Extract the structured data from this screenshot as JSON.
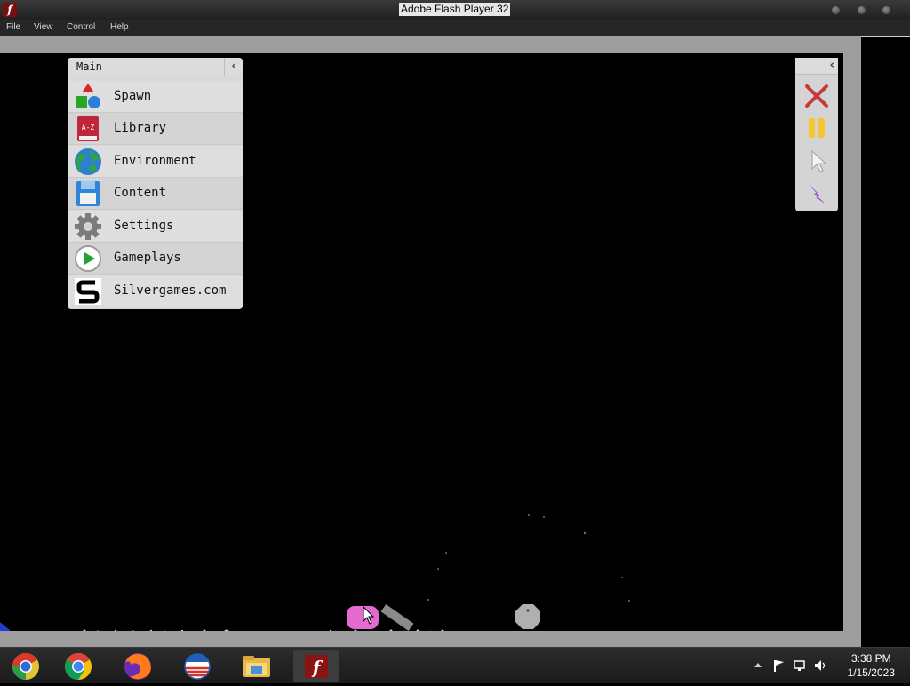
{
  "window": {
    "title": "Adobe Flash Player 32"
  },
  "menubar": {
    "items": [
      "File",
      "View",
      "Control",
      "Help"
    ]
  },
  "main_panel": {
    "title": "Main",
    "items": [
      {
        "label": "Spawn",
        "icon": "shapes-icon"
      },
      {
        "label": "Library",
        "icon": "book-icon"
      },
      {
        "label": "Environment",
        "icon": "globe-icon"
      },
      {
        "label": "Content",
        "icon": "floppy-disk-icon"
      },
      {
        "label": "Settings",
        "icon": "gear-icon"
      },
      {
        "label": "Gameplays",
        "icon": "play-icon"
      },
      {
        "label": "Silvergames.com",
        "icon": "silvergames-logo-icon"
      }
    ]
  },
  "library_icon_text": "A-Z",
  "tool_panel": {
    "tools": [
      "close-icon",
      "pause-icon",
      "cursor-icon",
      "lightning-icon"
    ]
  },
  "taskbar": {
    "apps": [
      "chrome-icon",
      "chrome-icon",
      "firefox-icon",
      "browser-icon",
      "file-explorer-icon",
      "flash-player-icon"
    ],
    "time": "3:38 PM",
    "date": "1/15/2023"
  },
  "colors": {
    "titlebar": "#2a2a2a",
    "panel_bg": "#d9d9d9",
    "stage_bg": "#000000",
    "pink_object": "#e36bd0"
  }
}
